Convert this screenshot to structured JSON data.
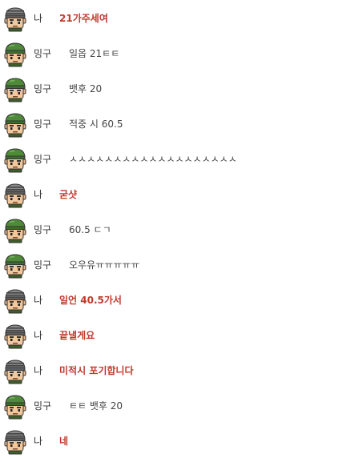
{
  "colors": {
    "me_text": "#c0392b",
    "other_text": "#444444",
    "speaker_text": "#333333",
    "helmet_green": "#4e8a3a",
    "helmet_gray": "#8a8a8a"
  },
  "messages": [
    {
      "speaker": "나",
      "is_me": true,
      "avatar": "gray-helmet-soldier-icon",
      "text": "21가주세여"
    },
    {
      "speaker": "밍구",
      "is_me": false,
      "avatar": "green-helmet-soldier-icon",
      "text": "일옵 21ㅌㅌ"
    },
    {
      "speaker": "밍구",
      "is_me": false,
      "avatar": "green-helmet-soldier-icon",
      "text": "뱃후 20"
    },
    {
      "speaker": "밍구",
      "is_me": false,
      "avatar": "green-helmet-soldier-icon",
      "text": "적중 시 60.5"
    },
    {
      "speaker": "밍구",
      "is_me": false,
      "avatar": "green-helmet-soldier-icon",
      "text": "ㅅㅅㅅㅅㅅㅅㅅㅅㅅㅅㅅㅅㅅㅅㅅㅅㅅㅅㅅ"
    },
    {
      "speaker": "나",
      "is_me": true,
      "avatar": "gray-helmet-soldier-icon",
      "text": "굳샷"
    },
    {
      "speaker": "밍구",
      "is_me": false,
      "avatar": "green-helmet-soldier-icon",
      "text": "60.5 ㄷㄱ"
    },
    {
      "speaker": "밍구",
      "is_me": false,
      "avatar": "green-helmet-soldier-icon",
      "text": "오우유ㅠㅠㅠㅠㅠ"
    },
    {
      "speaker": "나",
      "is_me": true,
      "avatar": "gray-helmet-soldier-icon",
      "text": "일언 40.5가서"
    },
    {
      "speaker": "나",
      "is_me": true,
      "avatar": "gray-helmet-soldier-icon",
      "text": "끝낼게요"
    },
    {
      "speaker": "나",
      "is_me": true,
      "avatar": "gray-helmet-soldier-icon",
      "text": "미적시 포기합니다"
    },
    {
      "speaker": "밍구",
      "is_me": false,
      "avatar": "green-helmet-soldier-icon",
      "text": "ㅌㅌ 뱃후 20"
    },
    {
      "speaker": "나",
      "is_me": true,
      "avatar": "gray-helmet-soldier-icon",
      "text": "네"
    }
  ]
}
